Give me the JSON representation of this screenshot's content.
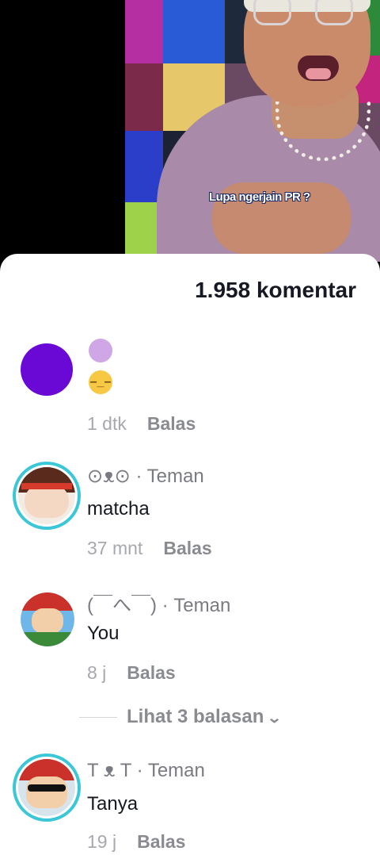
{
  "video": {
    "caption": "Lupa ngerjain PR ?",
    "colors": {
      "tile_magenta": "#b52fa2",
      "tile_blue": "#2a5bd6",
      "tile_green": "#9ed24a",
      "tile_yellow": "#e6c86a"
    }
  },
  "sheet": {
    "title": "1.958 komentar"
  },
  "comments": [
    {
      "avatar_color": "#6a08d6",
      "emoji_1": "",
      "emoji_2": "😑",
      "time": "1 dtk",
      "reply_label": "Balas"
    },
    {
      "name": "⊙ᴥ⊙ · Teman",
      "text": "matcha",
      "time": "37 mnt",
      "reply_label": "Balas"
    },
    {
      "name": "(￣へ￣) · Teman",
      "text": "You",
      "time": "8 j",
      "reply_label": "Balas",
      "view_replies": "Lihat 3 balasan"
    },
    {
      "name": "T ᴥ T · Teman",
      "text": "Tanya",
      "time": "19 j",
      "reply_label": "Balas"
    }
  ],
  "colors": {
    "story_ring": "#3cc7d8",
    "meta_gray": "#a7a8ae"
  }
}
